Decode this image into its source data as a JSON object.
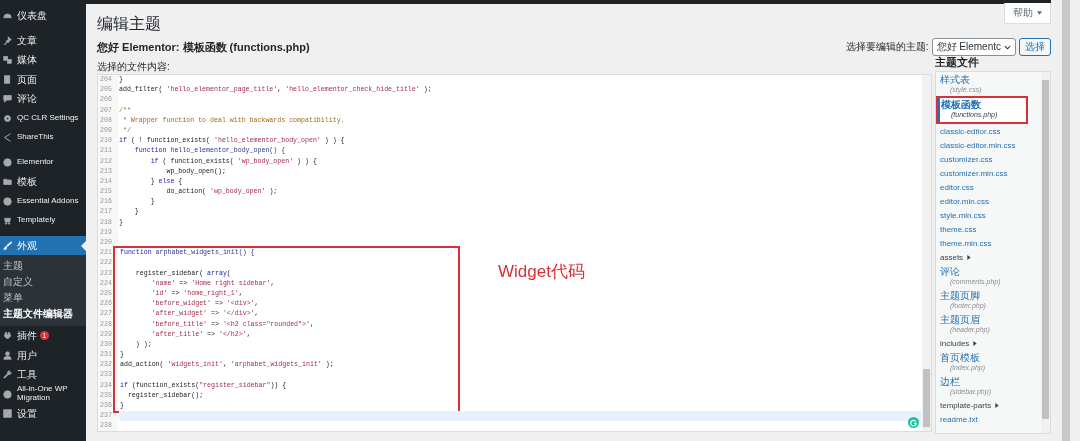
{
  "sidebar": {
    "groups": [
      [
        {
          "label": "仪表盘",
          "selected": false
        }
      ],
      [
        {
          "label": "文章",
          "selected": false
        },
        {
          "label": "媒体",
          "selected": false
        },
        {
          "label": "页面",
          "selected": false
        },
        {
          "label": "评论",
          "selected": false
        },
        {
          "label": "QC CLR Settings",
          "selected": false
        },
        {
          "label": "ShareThis",
          "selected": false
        }
      ],
      [
        {
          "label": "Elementor",
          "selected": false
        },
        {
          "label": "模板",
          "selected": false
        },
        {
          "label": "Essential Addons",
          "selected": false
        },
        {
          "label": "Templately",
          "selected": false
        }
      ],
      [
        {
          "label": "外观",
          "selected": true,
          "children": [
            {
              "label": "主题",
              "selected": false
            },
            {
              "label": "自定义",
              "selected": false
            },
            {
              "label": "菜单",
              "selected": false
            },
            {
              "label": "主题文件编辑器",
              "selected": true
            }
          ]
        },
        {
          "label": "插件",
          "selected": false,
          "badge": "1"
        },
        {
          "label": "用户",
          "selected": false
        },
        {
          "label": "工具",
          "selected": false
        },
        {
          "label": "All-in-One WP Migration",
          "selected": false
        },
        {
          "label": "设置",
          "selected": false
        }
      ]
    ]
  },
  "header": {
    "title": "编辑主题",
    "help_button": "帮助",
    "subtitle": "您好 Elementor: 模板函数 (functions.php)",
    "theme_select_label": "选择要编辑的主题:",
    "theme_select_value": "您好 Elementc",
    "select_button": "选择",
    "content_label": "选择的文件内容:"
  },
  "editor": {
    "annotation": "Widget代码",
    "blocks": [
      {
        "boxed": false,
        "lines": [
          {
            "number": "204",
            "current": false,
            "tokens": [
              {
                "kind": "plain",
                "text": "}"
              }
            ]
          },
          {
            "number": "205",
            "current": false,
            "tokens": [
              {
                "kind": "plain",
                "text": "add_filter( "
              },
              {
                "kind": "string",
                "text": "'hello_elementor_page_title'"
              },
              {
                "kind": "plain",
                "text": ", "
              },
              {
                "kind": "string",
                "text": "'hello_elementor_check_hide_title'"
              },
              {
                "kind": "plain",
                "text": " );"
              }
            ]
          },
          {
            "number": "206",
            "current": false
          },
          {
            "number": "207",
            "current": false,
            "tokens": [
              {
                "kind": "comment",
                "text": "/**"
              }
            ]
          },
          {
            "number": "208",
            "current": false,
            "tokens": [
              {
                "kind": "comment",
                "text": " * Wrapper function to deal with backwards compatibility."
              }
            ]
          },
          {
            "number": "209",
            "current": false,
            "tokens": [
              {
                "kind": "comment",
                "text": " */"
              }
            ]
          },
          {
            "number": "210",
            "current": false,
            "tokens": [
              {
                "kind": "keyword",
                "text": "if"
              },
              {
                "kind": "plain",
                "text": " ( ! function_exists( "
              },
              {
                "kind": "string",
                "text": "'hello_elementor_body_open'"
              },
              {
                "kind": "plain",
                "text": " ) ) {"
              }
            ]
          },
          {
            "number": "211",
            "current": false,
            "tokens": [
              {
                "kind": "keyword",
                "text": "    function"
              },
              {
                "kind": "def",
                "text": " hello_elementor_body_open() {"
              }
            ]
          },
          {
            "number": "212",
            "current": false,
            "tokens": [
              {
                "kind": "keyword",
                "text": "        if"
              },
              {
                "kind": "plain",
                "text": " ( function_exists( "
              },
              {
                "kind": "string",
                "text": "'wp_body_open'"
              },
              {
                "kind": "plain",
                "text": " ) ) {"
              }
            ]
          },
          {
            "number": "213",
            "current": false,
            "tokens": [
              {
                "kind": "plain",
                "text": "            wp_body_open();"
              }
            ]
          },
          {
            "number": "214",
            "current": false,
            "tokens": [
              {
                "kind": "plain",
                "text": "        } "
              },
              {
                "kind": "keyword",
                "text": "else"
              },
              {
                "kind": "plain",
                "text": " {"
              }
            ]
          },
          {
            "number": "215",
            "current": false,
            "tokens": [
              {
                "kind": "plain",
                "text": "            do_action( "
              },
              {
                "kind": "string",
                "text": "'wp_body_open'"
              },
              {
                "kind": "plain",
                "text": " );"
              }
            ]
          },
          {
            "number": "216",
            "current": false,
            "tokens": [
              {
                "kind": "plain",
                "text": "        }"
              }
            ]
          },
          {
            "number": "217",
            "current": false,
            "tokens": [
              {
                "kind": "plain",
                "text": "    }"
              }
            ]
          },
          {
            "number": "218",
            "current": false,
            "tokens": [
              {
                "kind": "plain",
                "text": "}"
              }
            ]
          },
          {
            "number": "219",
            "current": false
          },
          {
            "number": "220",
            "current": false
          }
        ]
      },
      {
        "boxed": true,
        "lines": [
          {
            "number": "221",
            "current": false,
            "tokens": [
              {
                "kind": "keyword",
                "text": "function"
              },
              {
                "kind": "def",
                "text": " arphabet_widgets_init() {"
              }
            ]
          },
          {
            "number": "222",
            "current": false
          },
          {
            "number": "223",
            "current": false,
            "tokens": [
              {
                "kind": "plain",
                "text": "    register_sidebar( "
              },
              {
                "kind": "keyword",
                "text": "array"
              },
              {
                "kind": "plain",
                "text": "("
              }
            ]
          },
          {
            "number": "224",
            "current": false,
            "tokens": [
              {
                "kind": "string",
                "text": "        'name'"
              },
              {
                "kind": "plain",
                "text": " => "
              },
              {
                "kind": "string",
                "text": "'Home right sidebar'"
              },
              {
                "kind": "plain",
                "text": ","
              }
            ]
          },
          {
            "number": "225",
            "current": false,
            "tokens": [
              {
                "kind": "string",
                "text": "        'id'"
              },
              {
                "kind": "plain",
                "text": " => "
              },
              {
                "kind": "string",
                "text": "'home_right_1'"
              },
              {
                "kind": "plain",
                "text": ","
              }
            ]
          },
          {
            "number": "226",
            "current": false,
            "tokens": [
              {
                "kind": "string",
                "text": "        'before_widget'"
              },
              {
                "kind": "plain",
                "text": " => "
              },
              {
                "kind": "string",
                "text": "'<div>'"
              },
              {
                "kind": "plain",
                "text": ","
              }
            ]
          },
          {
            "number": "227",
            "current": false,
            "tokens": [
              {
                "kind": "string",
                "text": "        'after_widget'"
              },
              {
                "kind": "plain",
                "text": " => "
              },
              {
                "kind": "string",
                "text": "'</div>'"
              },
              {
                "kind": "plain",
                "text": ","
              }
            ]
          },
          {
            "number": "228",
            "current": false,
            "tokens": [
              {
                "kind": "string",
                "text": "        'before_title'"
              },
              {
                "kind": "plain",
                "text": " => "
              },
              {
                "kind": "string",
                "text": "'<h2 class=\"rounded\">'"
              },
              {
                "kind": "plain",
                "text": ","
              }
            ]
          },
          {
            "number": "229",
            "current": false,
            "tokens": [
              {
                "kind": "string",
                "text": "        'after_title'"
              },
              {
                "kind": "plain",
                "text": " => "
              },
              {
                "kind": "string",
                "text": "'</h2>'"
              },
              {
                "kind": "plain",
                "text": ","
              }
            ]
          },
          {
            "number": "230",
            "current": false,
            "tokens": [
              {
                "kind": "plain",
                "text": "    ) );"
              }
            ]
          },
          {
            "number": "231",
            "current": false,
            "tokens": [
              {
                "kind": "plain",
                "text": "}"
              }
            ]
          },
          {
            "number": "232",
            "current": false,
            "tokens": [
              {
                "kind": "plain",
                "text": "add_action( "
              },
              {
                "kind": "string",
                "text": "'widgets_init'"
              },
              {
                "kind": "plain",
                "text": ", "
              },
              {
                "kind": "string",
                "text": "'arphabet_widgets_init'"
              },
              {
                "kind": "plain",
                "text": " );"
              }
            ]
          },
          {
            "number": "233",
            "current": false
          },
          {
            "number": "234",
            "current": false,
            "tokens": [
              {
                "kind": "keyword",
                "text": "if"
              },
              {
                "kind": "plain",
                "text": " (function_exists("
              },
              {
                "kind": "string",
                "text": "\"register_sidebar\""
              },
              {
                "kind": "plain",
                "text": ")) {"
              }
            ]
          },
          {
            "number": "235",
            "current": false,
            "tokens": [
              {
                "kind": "plain",
                "text": "  register_sidebar();"
              }
            ]
          },
          {
            "number": "236",
            "current": false,
            "tokens": [
              {
                "kind": "plain",
                "text": "}"
              }
            ]
          }
        ]
      },
      {
        "boxed": false,
        "lines": [
          {
            "number": "237",
            "current": true
          },
          {
            "number": "238",
            "current": false
          }
        ]
      }
    ]
  },
  "files": {
    "heading": "主题文件",
    "items": [
      {
        "kind": "file",
        "name": "样式表",
        "sub": "(style.css)",
        "selected": false,
        "boxed": false
      },
      {
        "kind": "file",
        "name": "模板函数",
        "sub": "(functions.php)",
        "selected": true,
        "boxed": true
      },
      {
        "kind": "file",
        "name": "classic-editor.css",
        "selected": false,
        "boxed": false
      },
      {
        "kind": "file",
        "name": "classic-editor.min.css",
        "selected": false,
        "boxed": false
      },
      {
        "kind": "file",
        "name": "customizer.css",
        "selected": false,
        "boxed": false
      },
      {
        "kind": "file",
        "name": "customizer.min.css",
        "selected": false,
        "boxed": false
      },
      {
        "kind": "file",
        "name": "editor.css",
        "selected": false,
        "boxed": false
      },
      {
        "kind": "file",
        "name": "editor.min.css",
        "selected": false,
        "boxed": false
      },
      {
        "kind": "file",
        "name": "style.min.css",
        "selected": false,
        "boxed": false
      },
      {
        "kind": "file",
        "name": "theme.css",
        "selected": false,
        "boxed": false
      },
      {
        "kind": "file",
        "name": "theme.min.css",
        "selected": false,
        "boxed": false
      },
      {
        "kind": "folder",
        "name": "assets",
        "selected": false,
        "boxed": false
      },
      {
        "kind": "file",
        "name": "评论",
        "sub": "(comments.php)",
        "selected": false,
        "boxed": false
      },
      {
        "kind": "file",
        "name": "主题页脚",
        "sub": "(footer.php)",
        "selected": false,
        "boxed": false
      },
      {
        "kind": "file",
        "name": "主题页眉",
        "sub": "(header.php)",
        "selected": false,
        "boxed": false
      },
      {
        "kind": "folder",
        "name": "includes",
        "selected": false,
        "boxed": false
      },
      {
        "kind": "file",
        "name": "首页模板",
        "sub": "(index.php)",
        "selected": false,
        "boxed": false
      },
      {
        "kind": "file",
        "name": "边栏",
        "sub": "(sidebar.php)",
        "selected": false,
        "boxed": false
      },
      {
        "kind": "folder",
        "name": "template-parts",
        "selected": false,
        "boxed": false
      },
      {
        "kind": "file",
        "name": "readme.txt",
        "selected": false,
        "boxed": false
      }
    ]
  }
}
